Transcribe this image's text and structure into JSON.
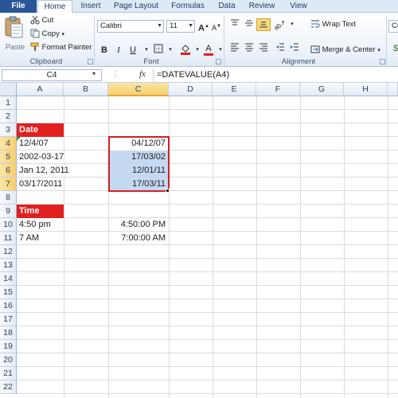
{
  "ribbon": {
    "tabs": [
      "File",
      "Home",
      "Insert",
      "Page Layout",
      "Formulas",
      "Data",
      "Review",
      "View"
    ],
    "clipboard": {
      "paste": "Paste",
      "cut": "Cut",
      "copy": "Copy",
      "format_painter": "Format Painter",
      "label": "Clipboard"
    },
    "font": {
      "name": "Calibri",
      "size": "11",
      "bold": "B",
      "italic": "I",
      "underline": "U",
      "label": "Font"
    },
    "alignment": {
      "wrap_text": "Wrap Text",
      "merge_center": "Merge & Center",
      "label": "Alignment"
    },
    "number": {
      "format_partial": "Cu"
    }
  },
  "formula_bar": {
    "name_box": "C4",
    "fx": "fx",
    "formula": "=DATEVALUE(A4)"
  },
  "sheet": {
    "columns": [
      "A",
      "B",
      "C",
      "D",
      "E",
      "F",
      "G",
      "H"
    ],
    "rows": [
      "1",
      "2",
      "3",
      "4",
      "5",
      "6",
      "7",
      "8",
      "9",
      "10",
      "11",
      "12",
      "13",
      "14",
      "15",
      "16",
      "17",
      "18",
      "19",
      "20",
      "21",
      "22"
    ],
    "selected_column": "C",
    "selected_rows": [
      "4",
      "5",
      "6",
      "7"
    ],
    "cells": {
      "A3": "Date",
      "A4": "12/4/07",
      "A5": "2002-03-17",
      "A6": "Jan 12, 2011",
      "A7": "03/17/2011",
      "C4": "04/12/07",
      "C5": "17/03/02",
      "C6": "12/01/11",
      "C7": "17/03/11",
      "A9": "Time",
      "A10": "4:50 pm",
      "A11": "7 AM",
      "C10": "4:50:00 PM",
      "C11": "7:00:00 AM"
    }
  },
  "colors": {
    "header_fill": "#e2201f",
    "selection_fill": "#c5d9f1",
    "highlight_border": "#d11f26",
    "file_tab": "#2a5699"
  }
}
